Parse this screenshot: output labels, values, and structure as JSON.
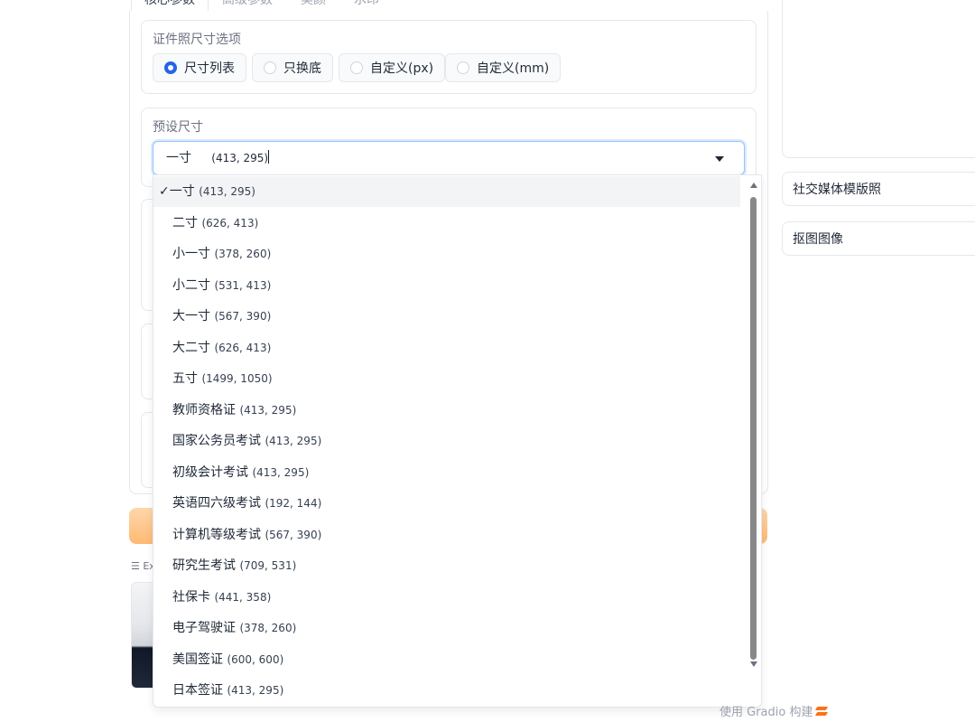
{
  "tabs": [
    {
      "label": "核心参数",
      "active": true
    },
    {
      "label": "高级参数",
      "active": false
    },
    {
      "label": "美颜",
      "active": false
    },
    {
      "label": "水印",
      "active": false
    }
  ],
  "size_mode": {
    "label": "证件照尺寸选项",
    "options": [
      "尺寸列表",
      "只换底",
      "自定义(px)",
      "自定义(mm)"
    ],
    "selected": "尺寸列表"
  },
  "preset_size": {
    "label": "预设尺寸",
    "value_name": "一寸",
    "value_size": "(413, 295)",
    "options": [
      {
        "name": "一寸",
        "size": "(413, 295)",
        "selected": true
      },
      {
        "name": "二寸",
        "size": "(626, 413)"
      },
      {
        "name": "小一寸",
        "size": "(378, 260)"
      },
      {
        "name": "小二寸",
        "size": "(531, 413)"
      },
      {
        "name": "大一寸",
        "size": "(567, 390)"
      },
      {
        "name": "大二寸",
        "size": "(626, 413)"
      },
      {
        "name": "五寸",
        "size": "(1499, 1050)"
      },
      {
        "name": "教师资格证",
        "size": "(413, 295)"
      },
      {
        "name": "国家公务员考试",
        "size": "(413, 295)"
      },
      {
        "name": "初级会计考试",
        "size": "(413, 295)"
      },
      {
        "name": "英语四六级考试",
        "size": "(192, 144)"
      },
      {
        "name": "计算机等级考试",
        "size": "(567, 390)"
      },
      {
        "name": "研究生考试",
        "size": "(709, 531)"
      },
      {
        "name": "社保卡",
        "size": "(441, 358)"
      },
      {
        "name": "电子驾驶证",
        "size": "(378, 260)"
      },
      {
        "name": "美国签证",
        "size": "(600, 600)"
      },
      {
        "name": "日本签证",
        "size": "(413, 295)"
      }
    ]
  },
  "examples": {
    "label": "Ex"
  },
  "right": {
    "accordions": [
      "社交媒体模版照",
      "抠图图像"
    ]
  },
  "footer": {
    "text": "使用 Gradio 构建"
  },
  "colors": {
    "accent": "#2563eb",
    "submit_button": "#fdba74",
    "border": "#e5e7eb"
  }
}
